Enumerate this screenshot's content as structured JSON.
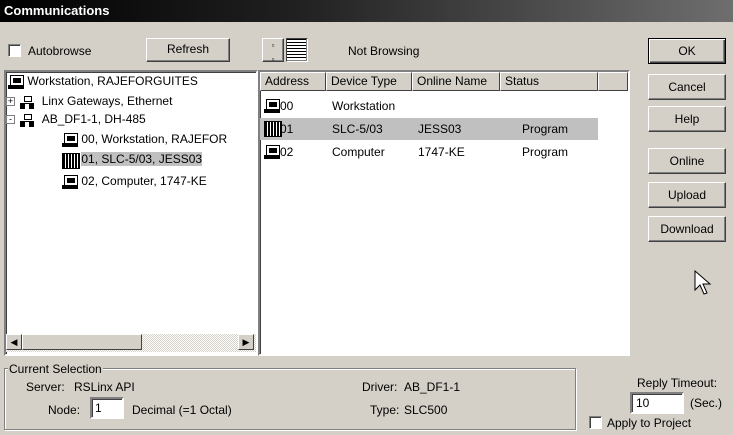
{
  "window": {
    "title": "Communications"
  },
  "toolbar": {
    "autobrowse_label": "Autobrowse",
    "autobrowse_checked": false,
    "refresh_label": "Refresh",
    "status_text": "Not Browsing"
  },
  "tree": {
    "items": [
      {
        "label": "Workstation, RAJEFORGUITES",
        "icon": "computer-icon"
      },
      {
        "label": "Linx Gateways, Ethernet",
        "icon": "network-icon",
        "expander": "+"
      },
      {
        "label": "AB_DF1-1, DH-485",
        "icon": "network-icon",
        "expander": "-"
      },
      {
        "label": "00, Workstation, RAJEFOR",
        "icon": "computer-icon"
      },
      {
        "label": "01, SLC-5/03, JESS03",
        "icon": "plc-icon",
        "selected": true
      },
      {
        "label": "02, Computer, 1747-KE",
        "icon": "computer-icon"
      }
    ]
  },
  "device_list": {
    "columns": [
      "Address",
      "Device Type",
      "Online Name",
      "Status"
    ],
    "rows": [
      {
        "address": "00",
        "device_type": "Workstation",
        "online_name": "",
        "status": "",
        "icon": "computer-icon"
      },
      {
        "address": "01",
        "device_type": "SLC-5/03",
        "online_name": "JESS03",
        "status": "Program",
        "icon": "plc-icon",
        "selected": true
      },
      {
        "address": "02",
        "device_type": "Computer",
        "online_name": "1747-KE",
        "status": "Program",
        "icon": "computer-icon"
      }
    ]
  },
  "buttons": {
    "ok": "OK",
    "cancel": "Cancel",
    "help": "Help",
    "online": "Online",
    "upload": "Upload",
    "download": "Download"
  },
  "current_selection": {
    "legend": "Current Selection",
    "server_label": "Server:",
    "server_value": "RSLinx API",
    "node_label": "Node:",
    "node_value": "1",
    "node_format": "Decimal (=1 Octal)",
    "driver_label": "Driver:",
    "driver_value": "AB_DF1-1",
    "type_label": "Type:",
    "type_value": "SLC500"
  },
  "reply": {
    "timeout_label": "Reply Timeout:",
    "timeout_value": "10",
    "unit_label": "(Sec.)",
    "apply_label": "Apply to Project",
    "apply_checked": false
  }
}
